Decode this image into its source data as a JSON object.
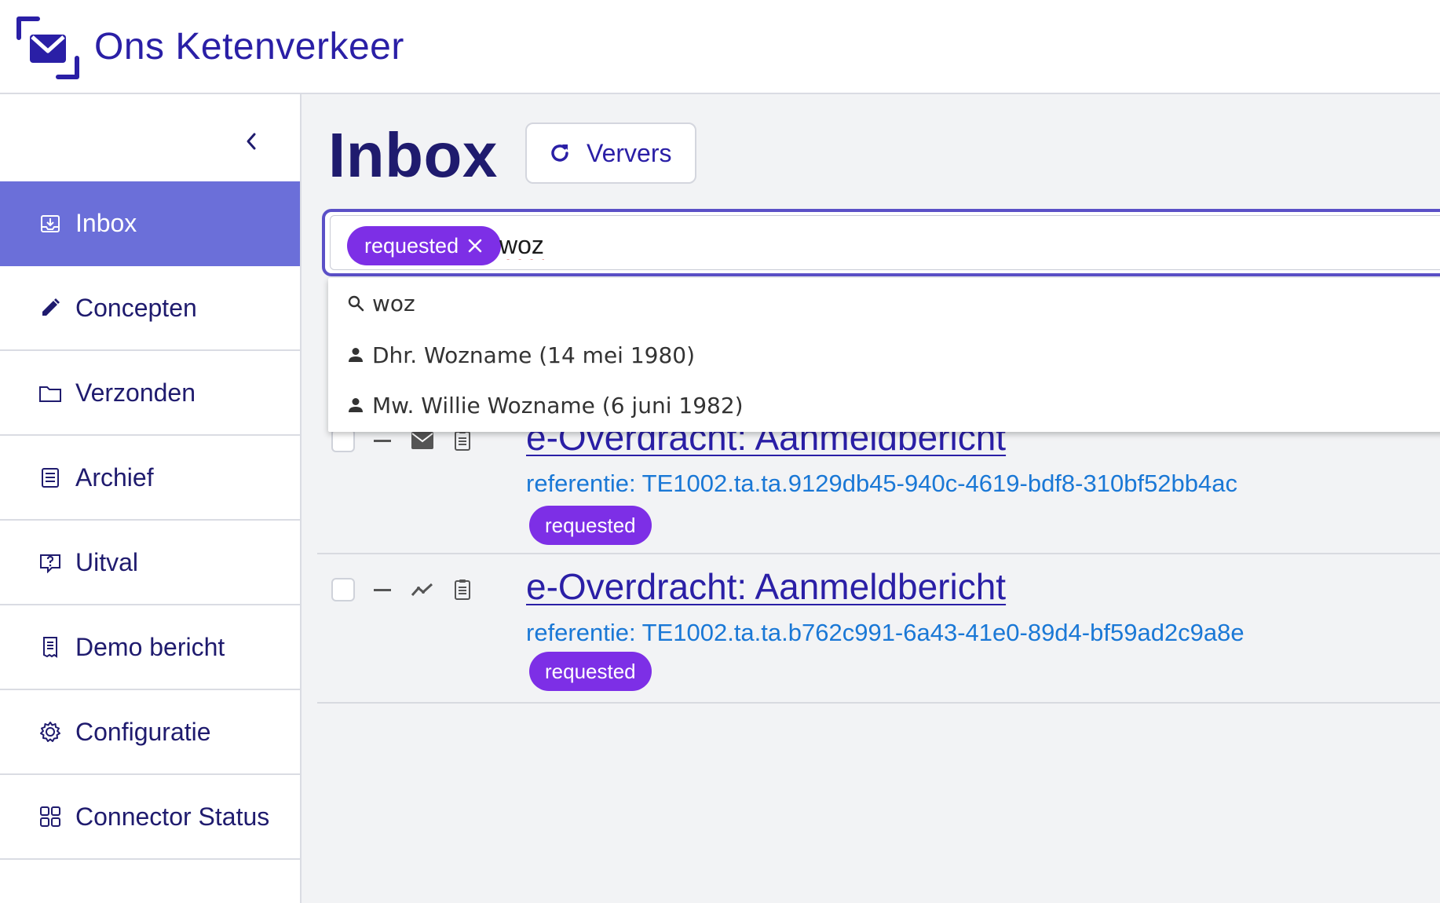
{
  "app": {
    "title": "Ons Ketenverkeer"
  },
  "sidebar": {
    "items": [
      {
        "label": "Inbox",
        "icon": "inbox-icon",
        "active": true
      },
      {
        "label": "Concepten",
        "icon": "pencil-icon"
      },
      {
        "label": "Verzonden",
        "icon": "folder-icon"
      },
      {
        "label": "Archief",
        "icon": "archive-icon"
      },
      {
        "label": "Uitval",
        "icon": "alert-message-icon"
      },
      {
        "label": "Demo bericht",
        "icon": "receipt-icon"
      },
      {
        "label": "Configuratie",
        "icon": "gear-icon"
      },
      {
        "label": "Connector Status",
        "icon": "grid-icon"
      }
    ]
  },
  "main": {
    "title": "Inbox",
    "refresh_label": "Ververs",
    "search": {
      "chip_label": "requested",
      "value": "woz",
      "suggestions": [
        {
          "label": "woz",
          "icon": "search-icon"
        },
        {
          "label": "Dhr. Wozname (14 mei 1980)",
          "icon": "person-icon"
        },
        {
          "label": "Mw. Willie Wozname (6 juni 1982)",
          "icon": "person-icon"
        }
      ]
    },
    "messages": [
      {
        "title": "e-Overdracht: Aanmeldbericht",
        "reference": "referentie: TE1002.ta.ta.9129db45-940c-4619-bdf8-310bf52bb4ac",
        "status": "requested",
        "channel_icon": "envelope-icon"
      },
      {
        "title": "e-Overdracht: Aanmeldbericht",
        "reference": "referentie: TE1002.ta.ta.b762c991-6a43-41e0-89d4-bf59ad2c9a8e",
        "status": "requested",
        "channel_icon": "trend-icon"
      }
    ]
  },
  "colors": {
    "accent": "#6b6fd9",
    "badge": "#7d2fe6",
    "link": "#2a1fa6",
    "reference": "#1a78d6"
  }
}
